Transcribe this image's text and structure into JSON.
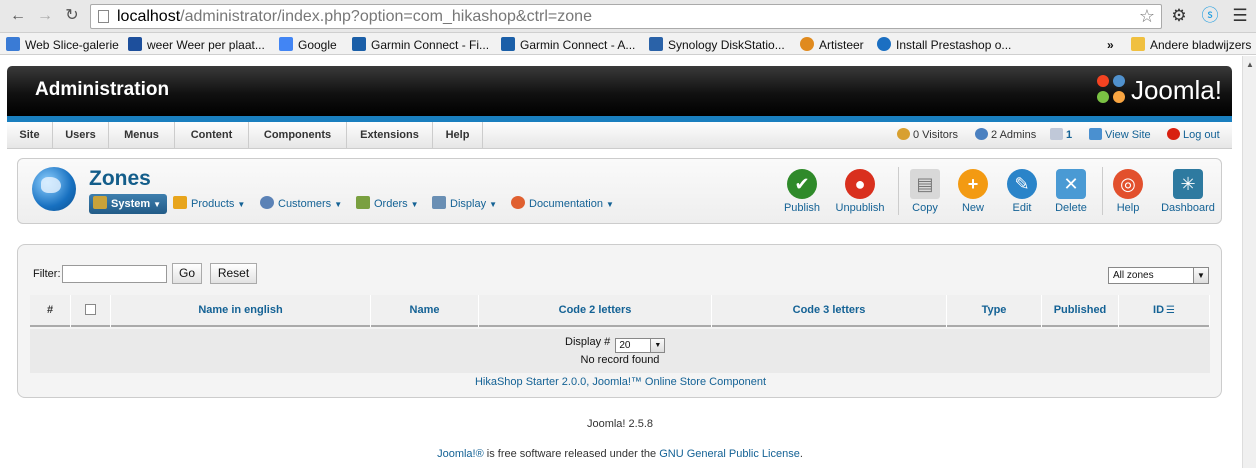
{
  "browser": {
    "url_host": "localhost",
    "url_rest": "/administrator/index.php?option=com_hikashop&ctrl=zone"
  },
  "bookmarks": [
    {
      "label": "Web Slice-galerie",
      "color": "#3a7bd5"
    },
    {
      "label": "weer Weer per plaat...",
      "color": "#1d4f9c"
    },
    {
      "label": "Google",
      "color": "#4285f4"
    },
    {
      "label": "Garmin Connect - Fi...",
      "color": "#1b5fa8"
    },
    {
      "label": "Garmin Connect - A...",
      "color": "#1b5fa8"
    },
    {
      "label": "Synology DiskStatio...",
      "color": "#2a62a8"
    },
    {
      "label": "Artisteer",
      "color": "#e08a1e"
    },
    {
      "label": "Install Prestashop o...",
      "color": "#1b6fc2"
    }
  ],
  "bookmarks_overflow": "»",
  "other_bookmarks": "Andere bladwijzers",
  "header": {
    "title": "Administration",
    "logo_text": "Joomla!"
  },
  "menu": [
    "Site",
    "Users",
    "Menus",
    "Content",
    "Components",
    "Extensions",
    "Help"
  ],
  "status": {
    "visitors": "0 Visitors",
    "admins": "2 Admins",
    "messages": "1",
    "view_site": "View Site",
    "logout": "Log out"
  },
  "page_title": "Zones",
  "submenu": [
    {
      "label": "System",
      "color": "#c9a23a"
    },
    {
      "label": "Products",
      "color": "#e8a51c"
    },
    {
      "label": "Customers",
      "color": "#5b82b6"
    },
    {
      "label": "Orders",
      "color": "#7aa040"
    },
    {
      "label": "Display",
      "color": "#6a8fb4"
    },
    {
      "label": "Documentation",
      "color": "#e06030"
    }
  ],
  "toolbar": [
    {
      "label": "Publish",
      "color": "#2f8a2a",
      "glyph": "✔"
    },
    {
      "label": "Unpublish",
      "color": "#d9301e",
      "glyph": "●"
    },
    {
      "label": "Copy",
      "color": "#bfbfbf",
      "glyph": "▤"
    },
    {
      "label": "New",
      "color": "#f39a12",
      "glyph": "+"
    },
    {
      "label": "Edit",
      "color": "#2a84c9",
      "glyph": "✎"
    },
    {
      "label": "Delete",
      "color": "#4a9ad4",
      "glyph": "✕"
    },
    {
      "label": "Help",
      "color": "#e2502d",
      "glyph": "◎"
    },
    {
      "label": "Dashboard",
      "color": "#2e7aa0",
      "glyph": "✳"
    }
  ],
  "filter": {
    "label": "Filter:",
    "value": "",
    "go": "Go",
    "reset": "Reset",
    "zone_select": "All zones"
  },
  "table": {
    "headers": [
      "#",
      "",
      "Name in english",
      "Name",
      "Code 2 letters",
      "Code 3 letters",
      "Type",
      "Published",
      "ID"
    ],
    "display_label": "Display #",
    "display_value": "20",
    "empty": "No record found"
  },
  "credit": "HikaShop Starter 2.0.0, Joomla!™ Online Store Component",
  "footer": {
    "version": "Joomla! 2.5.8",
    "license_a": "Joomla!®",
    "license_mid": " is free software released under the ",
    "license_b": "GNU General Public License",
    "license_end": "."
  }
}
